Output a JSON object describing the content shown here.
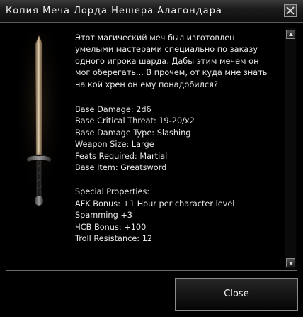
{
  "window": {
    "title": "Копия Меча Лорда Нешера Алагондара",
    "close_icon": "close-x-icon"
  },
  "item": {
    "image": "greatsword-image",
    "description": "Этот магический меч был изготовлен умелыми мастерами специально по заказу одного игрока шарда. Дабы этим мечем он мог оберегать... В прочем, от куда мне знать на кой хрен он ему понадобился?",
    "properties": [
      "Base Damage: 2d6",
      "Base Critical Threat: 19-20/x2",
      "Base Damage Type: Slashing",
      "Weapon Size: Large",
      "Feats Required: Martial",
      "Base Item: Greatsword"
    ],
    "special_header": "Special Properties:",
    "special_properties": [
      "AFK Bonus: +1 Hour per character level",
      "Spamming +3",
      "ЧСВ Bonus: +100",
      "Troll Resistance: 12"
    ]
  },
  "scrollbar": {
    "up_icon": "arrow-up-icon",
    "down_icon": "arrow-down-icon"
  },
  "footer": {
    "close_label": "Close"
  }
}
